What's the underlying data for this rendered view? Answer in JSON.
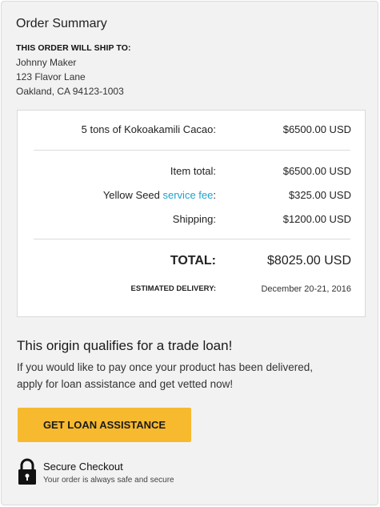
{
  "summary": {
    "title": "Order Summary",
    "ship_heading": "THIS ORDER WILL SHIP TO:",
    "address": [
      "Johnny Maker",
      "123 Flavor Lane",
      "Oakland, CA 94123-1003"
    ]
  },
  "order": {
    "item_label": "5 tons of Kokoakamili Cacao:",
    "item_value": "$6500.00 USD",
    "item_total_label": "Item total:",
    "item_total_value": "$6500.00 USD",
    "fee_prefix": "Yellow Seed ",
    "fee_link": "service fee",
    "fee_suffix": ":",
    "fee_value": "$325.00 USD",
    "shipping_label": "Shipping:",
    "shipping_value": "$1200.00 USD",
    "total_label": "TOTAL:",
    "total_value": "$8025.00 USD",
    "delivery_label": "ESTIMATED DELIVERY:",
    "delivery_value": "December 20-21, 2016"
  },
  "loan": {
    "title": "This origin qualifies for a trade loan!",
    "text_lines": [
      "If you would like to pay once your product has been delivered,",
      "apply for loan assistance and get vetted now!"
    ],
    "button_label": "GET LOAN ASSISTANCE"
  },
  "secure": {
    "icon": "lock-icon",
    "title": "Secure Checkout",
    "subtitle": "Your order is always safe and secure"
  },
  "colors": {
    "accent_button": "#f7b92e",
    "link": "#1ba3cf",
    "panel_bg": "#f2f2f2"
  }
}
